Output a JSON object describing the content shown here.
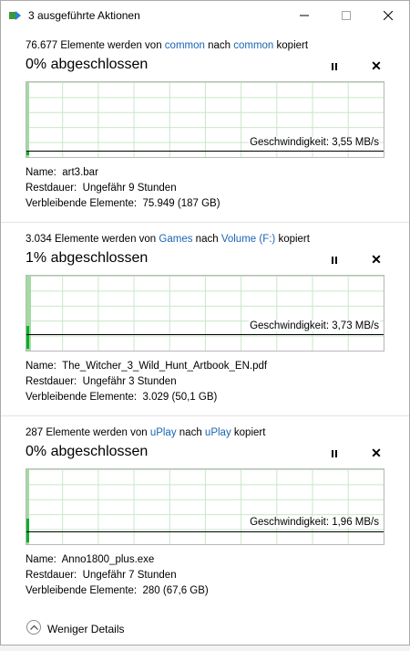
{
  "window": {
    "title": "3 ausgeführte Aktionen",
    "minimize_label": "—",
    "maximize_label": "☐",
    "close_label": "✕"
  },
  "operations": [
    {
      "prefix": "76.677 Elemente werden von ",
      "source": "common",
      "middle": " nach ",
      "target": "common",
      "suffix": " kopiert",
      "percent_text": "0% abgeschlossen",
      "progress": 0.005,
      "speed_level": 0.05,
      "speed_text": "Geschwindigkeit: 3,55 MB/s",
      "name_label": "Name:",
      "name_value": "art3.bar",
      "remaining_time_label": "Restdauer:",
      "remaining_time_value": "Ungefähr 9 Stunden",
      "remaining_items_label": "Verbleibende Elemente:",
      "remaining_items_value": "75.949 (187 GB)"
    },
    {
      "prefix": "3.034 Elemente werden von ",
      "source": "Games",
      "middle": " nach ",
      "target": "Volume (F:)",
      "suffix": " kopiert",
      "percent_text": "1% abgeschlossen",
      "progress": 0.012,
      "speed_level": 0.3,
      "speed_text": "Geschwindigkeit: 3,73 MB/s",
      "name_label": "Name:",
      "name_value": "The_Witcher_3_Wild_Hunt_Artbook_EN.pdf",
      "remaining_time_label": "Restdauer:",
      "remaining_time_value": "Ungefähr 3 Stunden",
      "remaining_items_label": "Verbleibende Elemente:",
      "remaining_items_value": "3.029 (50,1 GB)"
    },
    {
      "prefix": "287 Elemente werden von ",
      "source": "uPlay",
      "middle": " nach ",
      "target": "uPlay",
      "suffix": " kopiert",
      "percent_text": "0% abgeschlossen",
      "progress": 0.004,
      "speed_level": 0.32,
      "speed_text": "Geschwindigkeit: 1,96 MB/s",
      "name_label": "Name:",
      "name_value": "Anno1800_plus.exe",
      "remaining_time_label": "Restdauer:",
      "remaining_time_value": "Ungefähr 7 Stunden",
      "remaining_items_label": "Verbleibende Elemente:",
      "remaining_items_value": "280 (67,6 GB)"
    }
  ],
  "footer": {
    "less_details_label": "Weniger Details"
  },
  "colors": {
    "link": "#1a64b4",
    "progress_fill": "#a2dba2",
    "speed_bar": "#06b025",
    "grid": "#c9e6c9"
  }
}
